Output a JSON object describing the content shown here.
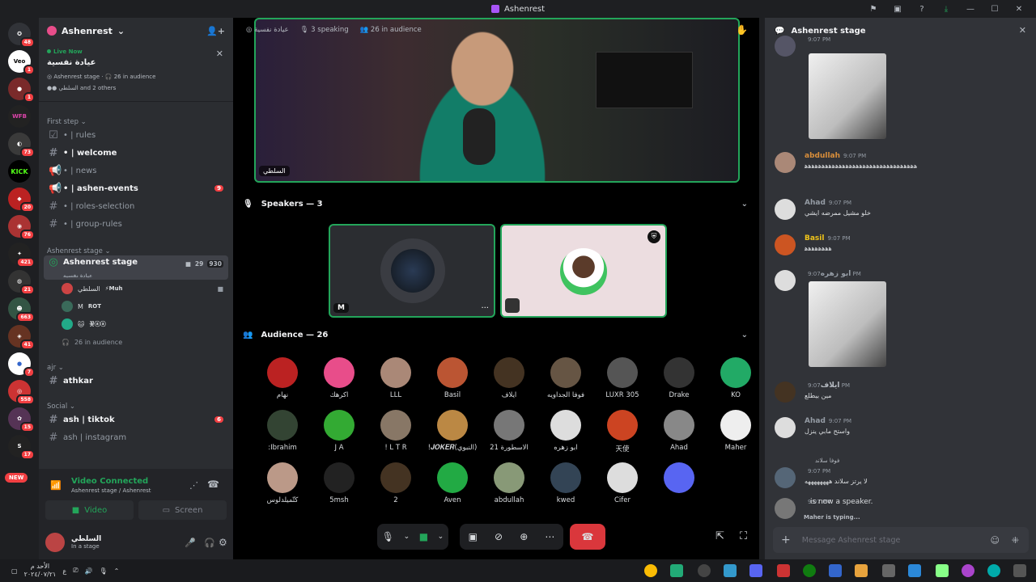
{
  "window": {
    "title": "Ashenrest"
  },
  "rail": {
    "badges": [
      "48",
      "1",
      "1",
      "",
      "73",
      "",
      "20",
      "76",
      "421",
      "21",
      "663",
      "41",
      "7",
      "558",
      "15",
      "17"
    ],
    "new_label": "NEW",
    "kick": "KICK"
  },
  "server": {
    "name": "Ashenrest"
  },
  "live": {
    "label": "Live Now",
    "title": "عيادة نفسية",
    "meta_stage": "Ashenrest stage",
    "meta_audience": "26 in audience",
    "participants": "السلطي and 2 others"
  },
  "categories": {
    "first_stage": "First step",
    "ashenrest_stage": "Ashenrest stage",
    "ajr": "ajr",
    "social": "Social"
  },
  "channels": [
    {
      "name": "• | rules",
      "bold": false
    },
    {
      "name": "• | welcome",
      "bold": true
    },
    {
      "name": "• | news",
      "bold": false
    },
    {
      "name": "• | ashen-events",
      "bold": true,
      "badge": "9"
    },
    {
      "name": "• | roles-selection",
      "bold": false
    },
    {
      "name": "• | group-rules",
      "bold": false
    }
  ],
  "stage_channel": {
    "name": "Ashenrest stage",
    "topic": "عيادة نفسية",
    "video_count": "29",
    "count": "930"
  },
  "stage_members": [
    {
      "name": "السلطي",
      "tag": "⚡Muh"
    },
    {
      "name": "M",
      "tag": "ROT"
    },
    {
      "name": "🐱",
      "tag": "꽃ⓐⓐ"
    }
  ],
  "stage_audience": "26 in audience",
  "ajr_channels": [
    {
      "name": "athkar"
    }
  ],
  "social_channels": [
    {
      "name": "ash | tiktok",
      "badge": "6"
    },
    {
      "name": "ash | instagram"
    }
  ],
  "voice": {
    "status": "Video Connected",
    "location": "Ashenrest stage / Ashenrest",
    "video_btn": "Video",
    "screen_btn": "Screen"
  },
  "user": {
    "name": "السلطي",
    "status": "In a stage"
  },
  "stage": {
    "topic": "عيادة نفسية",
    "speaking": "3 speaking",
    "audience": "26 in audience",
    "video_label": "السلطي",
    "speakers_header": "Speakers — 3",
    "audience_header": "Audience — 26",
    "tile1_label": "M",
    "tile1_more": "···"
  },
  "audience": [
    "نهام",
    "اكرهك",
    "LLL",
    "Basil",
    "ايلاف",
    "فوفا الجداويه",
    "LUXR 305",
    "Drake",
    "KO",
    ":Ibrahim",
    "J A",
    "! L T R",
    "!𝑱𝑶𝑲𝑬𝑹(النبوي)",
    "الاسطورة 21",
    "ابو زهره",
    "天使",
    "Ahad",
    "Maher",
    "كُتُّميلدلوس",
    "5msh",
    "2",
    "Aven",
    "abdullah",
    "kwed",
    "Cifer",
    ""
  ],
  "chat": {
    "title": "Ashenrest stage",
    "messages": [
      {
        "author": "",
        "time": "9:07 PM",
        "text": ""
      },
      {
        "author": "abdullah",
        "time": "9:07 PM",
        "text": "ﻫﻫﻫﻫﻫﻫﻫﻫﻫﻫﻫﻫﻫﻫﻫﻫﻫﻫﻫﻫﻫﻫﻫﻫﻫﻫﻫﻫﻫﻫﻫﻫﻫ"
      },
      {
        "author": "Ahad",
        "time": "9:07 PM",
        "text": "خلو مشيل ممرضه ايشي"
      },
      {
        "author": "Basil",
        "time": "9:07 PM",
        "text": "ﻫﻫﻫﻫﻫﻫﻫﻫ"
      },
      {
        "author": "ابو زهره",
        "time": "9:07 PM",
        "text": ""
      },
      {
        "author": "ايلاف",
        "time": "9:07 PM",
        "text": "مين بيطلع"
      },
      {
        "author": "Ahad",
        "time": "9:07 PM",
        "text": "واستح مابي ينزل"
      },
      {
        "author": "",
        "time": "9:07 PM",
        "reply": "فوفا سلاند",
        "text": "لا يرتز سلاند ههههههههه"
      },
      {
        "author": "",
        "time": "9:07 PM",
        "text": "is now a speaker."
      }
    ],
    "typing": "Maher is typing...",
    "placeholder": "Message Ashenrest stage"
  },
  "taskbar": {
    "time": "الأحد م",
    "date": "٢٠٢٤/٠٧/٢١"
  }
}
